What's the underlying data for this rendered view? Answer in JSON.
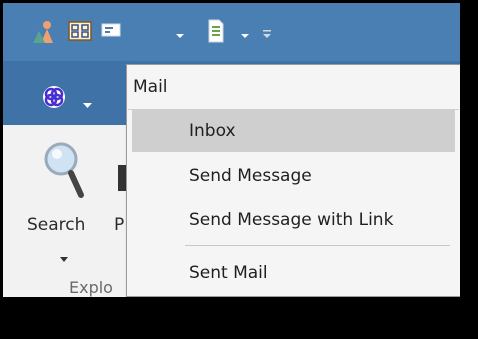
{
  "menu": {
    "header": "Mail",
    "items": [
      {
        "label": "Inbox",
        "selected": true
      },
      {
        "label": "Send Message",
        "selected": false
      },
      {
        "label": "Send Message with Link",
        "selected": false
      },
      {
        "label": "Sent Mail",
        "selected": false
      }
    ]
  },
  "ribbon": {
    "search_label": "Search",
    "partial_label": "P",
    "group_label": "Explo"
  },
  "icons": {
    "qat": [
      "people-icon",
      "diagram-icon",
      "mail-icon",
      "document-icon",
      "customize-overflow-icon"
    ],
    "tabbar": [
      "perspective-icon"
    ],
    "ribbon": [
      "magnifier-icon"
    ]
  },
  "colors": {
    "qat_bg": "#4a7fb3",
    "tabbar_bg": "#3f73a8",
    "menu_selected": "#cfcfcf"
  }
}
